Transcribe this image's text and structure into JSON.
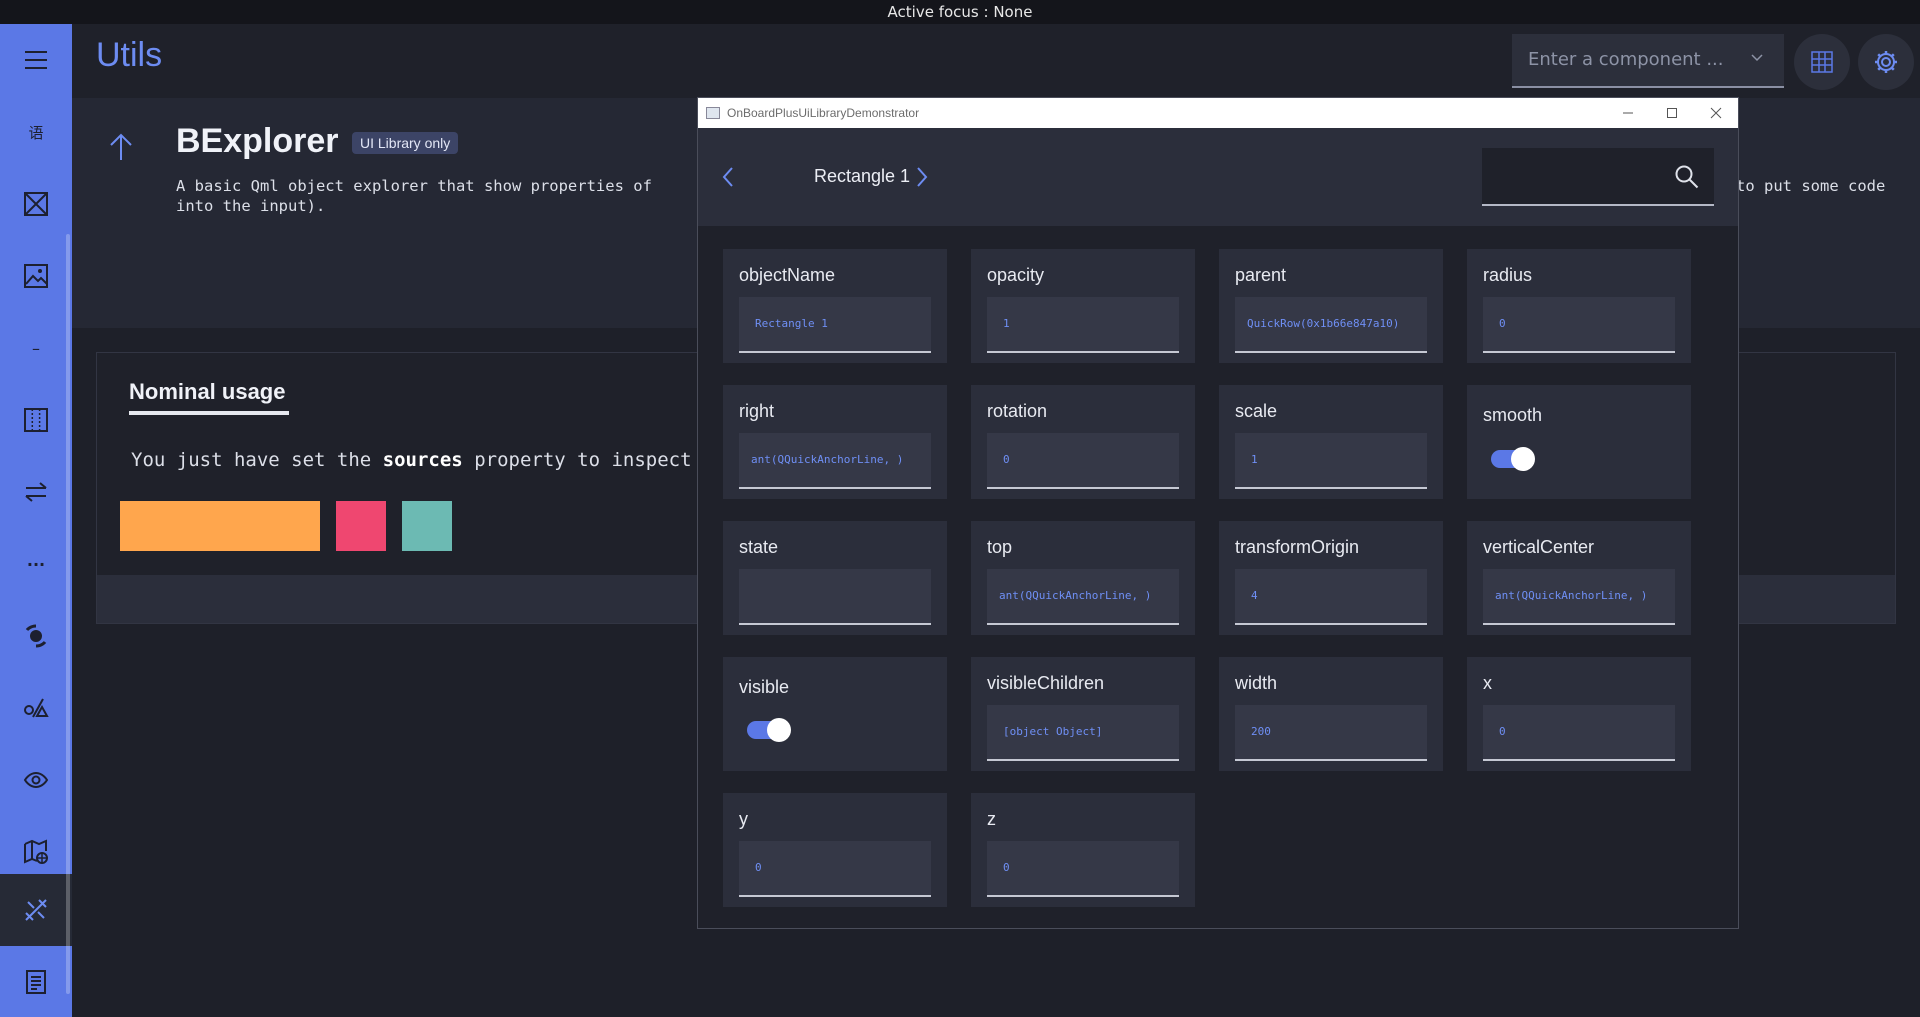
{
  "topbar": {
    "focus_text": "Active focus : None"
  },
  "header": {
    "title": "Utils",
    "component_select": {
      "placeholder": "Enter a component ..."
    }
  },
  "sidebar": {
    "items": [
      {
        "icon": "menu-icon"
      },
      {
        "icon": "language-icon",
        "label": "语"
      },
      {
        "icon": "frame-icon"
      },
      {
        "icon": "image-icon"
      },
      {
        "icon": "minus-icon",
        "label": "–"
      },
      {
        "icon": "grid-icon"
      },
      {
        "icon": "swap-icon"
      },
      {
        "icon": "more-icon",
        "label": "···"
      },
      {
        "icon": "storm-icon"
      },
      {
        "icon": "shapes-icon"
      },
      {
        "icon": "eye-icon"
      },
      {
        "icon": "map-icon"
      },
      {
        "icon": "tools-icon",
        "active": true
      },
      {
        "icon": "document-icon"
      }
    ]
  },
  "intro": {
    "title": "BExplorer",
    "badge": "UI Library only",
    "description_start": "A basic Qml object explorer that show properties of",
    "description_end": "to put some code",
    "description_line2": "into the input)."
  },
  "usage": {
    "tab": "Nominal usage",
    "text_before": "You just have set the ",
    "text_bold": "sources",
    "text_after": " property to inspect a",
    "rect_colors": [
      "#ffa64d",
      "#ef4770",
      "#6cbab3"
    ]
  },
  "window": {
    "title": "OnBoardPlusUiLibraryDemonstrator",
    "nav_label": "Rectangle 1",
    "search_value": "",
    "properties": [
      {
        "name": "objectName",
        "value": "Rectangle 1"
      },
      {
        "name": "opacity",
        "value": "1"
      },
      {
        "name": "parent",
        "value": "QuickRow(0x1b66e847a10)"
      },
      {
        "name": "radius",
        "value": "0"
      },
      {
        "name": "right",
        "value": "ant(QQuickAnchorLine, )"
      },
      {
        "name": "rotation",
        "value": "0"
      },
      {
        "name": "scale",
        "value": "1"
      },
      {
        "name": "smooth",
        "toggle": true
      },
      {
        "name": "state",
        "value": ""
      },
      {
        "name": "top",
        "value": "ant(QQuickAnchorLine, )"
      },
      {
        "name": "transformOrigin",
        "value": "4"
      },
      {
        "name": "verticalCenter",
        "value": "ant(QQuickAnchorLine, )"
      },
      {
        "name": "visible",
        "toggle": true
      },
      {
        "name": "visibleChildren",
        "value": "[object Object]"
      },
      {
        "name": "width",
        "value": "200"
      },
      {
        "name": "x",
        "value": "0"
      },
      {
        "name": "y",
        "value": "0"
      },
      {
        "name": "z",
        "value": "0"
      }
    ]
  },
  "colors": {
    "accent": "#5b78e6",
    "title_blue": "#6d8cf2",
    "bg": "#1e2029"
  }
}
